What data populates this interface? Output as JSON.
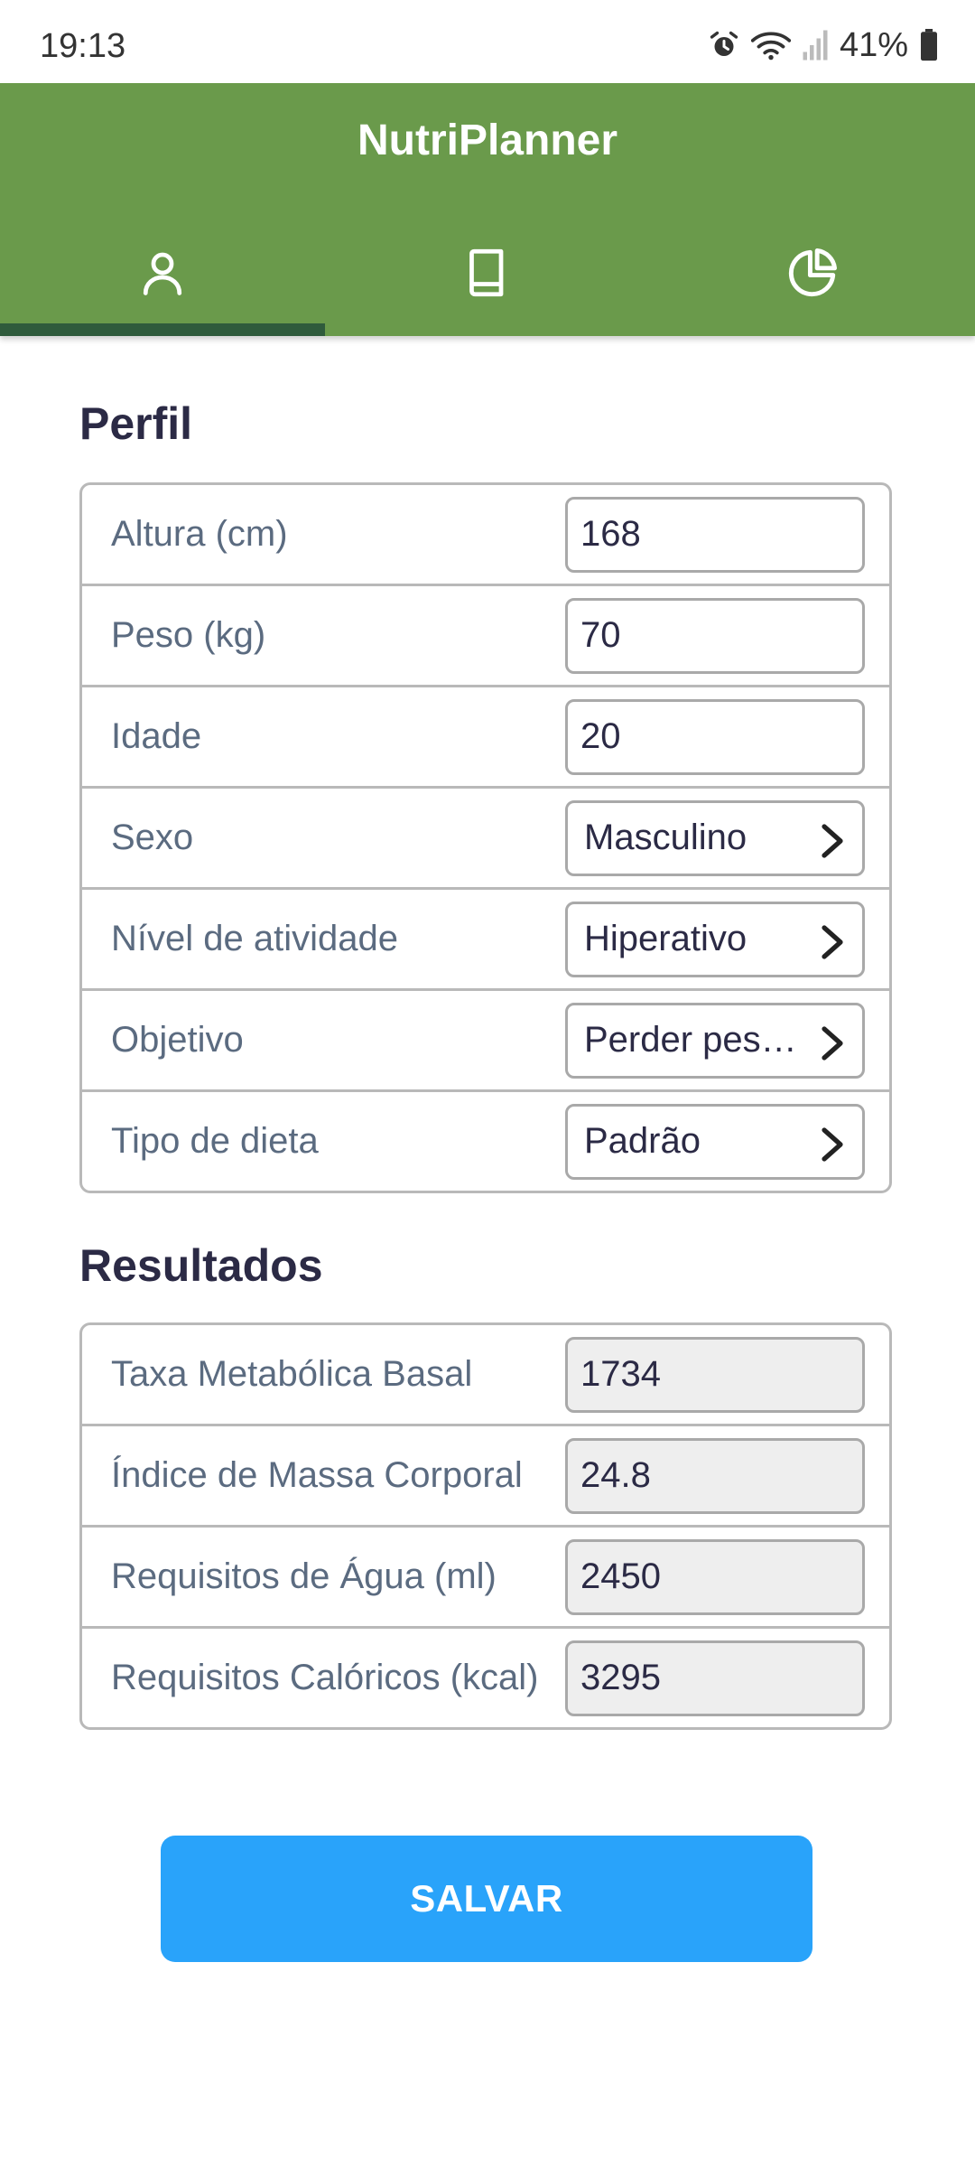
{
  "status_bar": {
    "time": "19:13",
    "battery": "41%"
  },
  "app": {
    "title": "NutriPlanner",
    "brand_color": "#6a9a4b",
    "tabs": [
      {
        "icon": "person-icon",
        "selected": true
      },
      {
        "icon": "book-icon",
        "selected": false
      },
      {
        "icon": "pie-chart-icon",
        "selected": false
      }
    ]
  },
  "profile": {
    "title": "Perfil",
    "height": {
      "label": "Altura (cm)",
      "value": "168"
    },
    "weight": {
      "label": "Peso (kg)",
      "value": "70"
    },
    "age": {
      "label": "Idade",
      "value": "20"
    },
    "sex": {
      "label": "Sexo",
      "value": "Masculino"
    },
    "activity": {
      "label": "Nível de atividade",
      "value": "Hiperativo"
    },
    "goal": {
      "label": "Objetivo",
      "value": "Perder peso…"
    },
    "diet": {
      "label": "Tipo de dieta",
      "value": "Padrão"
    }
  },
  "results": {
    "title": "Resultados",
    "bmr": {
      "label": "Taxa Metabólica Basal",
      "value": "1734"
    },
    "bmi": {
      "label": "Índice de Massa Corporal",
      "value": "24.8"
    },
    "water": {
      "label": "Requisitos de Água (ml)",
      "value": "2450"
    },
    "calories": {
      "label": "Requisitos Calóricos (kcal)",
      "value": "3295"
    }
  },
  "actions": {
    "save_label": "SALVAR",
    "save_color": "#29a3fa"
  }
}
